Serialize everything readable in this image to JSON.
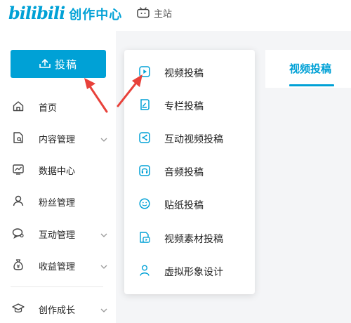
{
  "header": {
    "logo_text": "bilibili",
    "logo_subtitle": "创作中心",
    "home_label": "主站"
  },
  "sidebar": {
    "upload_label": "投稿",
    "items": [
      {
        "label": "首页",
        "icon": "home-icon",
        "expandable": false
      },
      {
        "label": "内容管理",
        "icon": "content-manage-icon",
        "expandable": true
      },
      {
        "label": "数据中心",
        "icon": "chart-icon",
        "expandable": false
      },
      {
        "label": "粉丝管理",
        "icon": "user-icon",
        "expandable": false
      },
      {
        "label": "互动管理",
        "icon": "chat-icon",
        "expandable": true
      },
      {
        "label": "收益管理",
        "icon": "money-bag-icon",
        "expandable": true
      },
      {
        "label": "创作成长",
        "icon": "graduation-cap-icon",
        "expandable": true
      }
    ]
  },
  "dropdown": {
    "items": [
      {
        "label": "视频投稿",
        "icon": "video-play-icon"
      },
      {
        "label": "专栏投稿",
        "icon": "article-edit-icon"
      },
      {
        "label": "互动视频投稿",
        "icon": "interactive-share-icon"
      },
      {
        "label": "音频投稿",
        "icon": "headphones-icon"
      },
      {
        "label": "贴纸投稿",
        "icon": "sticker-smile-icon"
      },
      {
        "label": "视频素材投稿",
        "icon": "video-material-icon"
      },
      {
        "label": "虚拟形象设计",
        "icon": "avatar-person-icon"
      }
    ]
  },
  "content": {
    "active_tab": "视频投稿"
  },
  "colors": {
    "accent": "#00a1d6",
    "annotation_arrow": "#e8413a",
    "background": "#f4f5f7"
  }
}
